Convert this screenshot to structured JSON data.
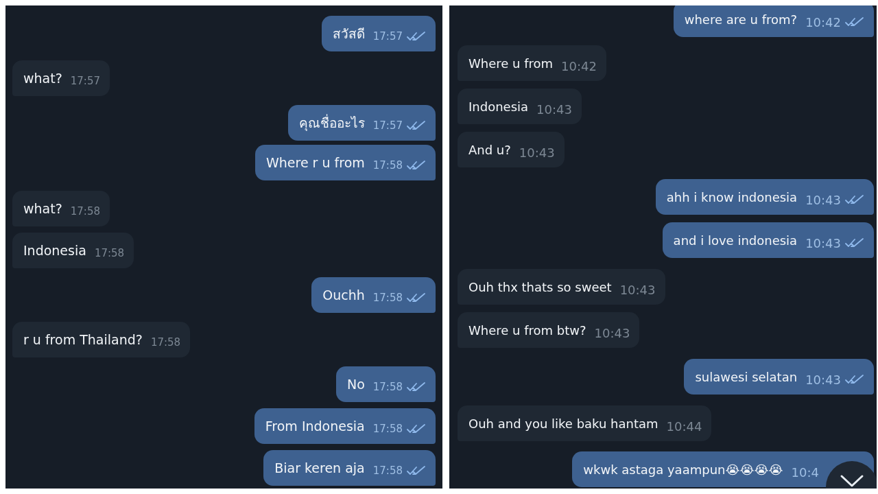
{
  "panels": [
    {
      "messages": [
        {
          "kind": "out",
          "text": "สวัสดี",
          "time": "17:57",
          "read": true
        },
        {
          "kind": "in",
          "text": "what?",
          "time": "17:57"
        },
        {
          "kind": "out",
          "text": "คุณชื่ออะไร",
          "time": "17:57",
          "read": true
        },
        {
          "kind": "out",
          "text": "Where r u from",
          "time": "17:58",
          "read": true
        },
        {
          "kind": "in",
          "text": "what?",
          "time": "17:58"
        },
        {
          "kind": "in",
          "text": "Indonesia",
          "time": "17:58"
        },
        {
          "kind": "out",
          "text": "Ouchh",
          "time": "17:58",
          "read": true
        },
        {
          "kind": "in",
          "text": "r u from Thailand?",
          "time": "17:58"
        },
        {
          "kind": "out",
          "text": "No",
          "time": "17:58",
          "read": true
        },
        {
          "kind": "out",
          "text": "From Indonesia",
          "time": "17:58",
          "read": true
        },
        {
          "kind": "out",
          "text": "Biar keren aja",
          "time": "17:58",
          "read": true
        }
      ]
    },
    {
      "messages": [
        {
          "kind": "out",
          "text": "where are u from?",
          "time": "10:42",
          "read": true
        },
        {
          "kind": "in",
          "text": "Where u from",
          "time": "10:42"
        },
        {
          "kind": "in",
          "text": "Indonesia",
          "time": "10:43"
        },
        {
          "kind": "in",
          "text": "And u?",
          "time": "10:43"
        },
        {
          "kind": "out",
          "text": "ahh i know indonesia",
          "time": "10:43",
          "read": true
        },
        {
          "kind": "out",
          "text": "and i love indonesia",
          "time": "10:43",
          "read": true
        },
        {
          "kind": "in",
          "text": "Ouh thx thats so sweet",
          "time": "10:43"
        },
        {
          "kind": "in",
          "text": "Where u from btw?",
          "time": "10:43"
        },
        {
          "kind": "out",
          "text": "sulawesi selatan",
          "time": "10:43",
          "read": true
        },
        {
          "kind": "in",
          "text": "Ouh and you like baku hantam",
          "time": "10:44"
        },
        {
          "kind": "out",
          "text": "wkwk astaga yaampun😭😭😭😭",
          "time": "10:4"
        }
      ],
      "scroll_down_button": true
    }
  ]
}
